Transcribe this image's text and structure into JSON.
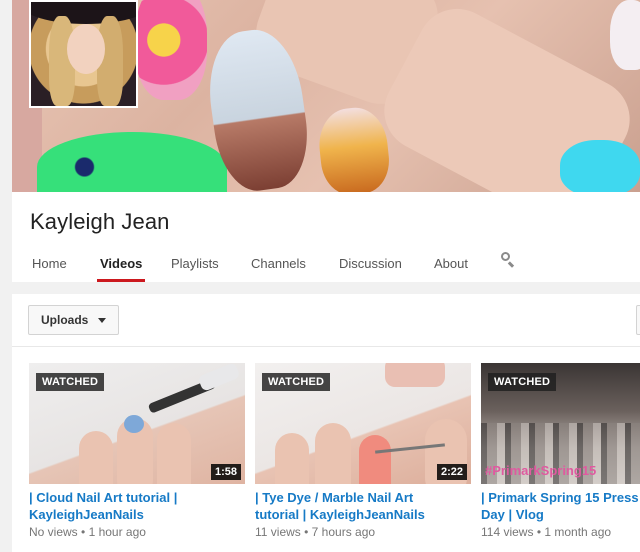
{
  "channel": {
    "name": "Kayleigh Jean",
    "tabs": [
      {
        "label": "Home",
        "active": false
      },
      {
        "label": "Videos",
        "active": true
      },
      {
        "label": "Playlists",
        "active": false
      },
      {
        "label": "Channels",
        "active": false
      },
      {
        "label": "Discussion",
        "active": false
      },
      {
        "label": "About",
        "active": false
      }
    ],
    "search_icon": "search-icon"
  },
  "filter": {
    "uploads_label": "Uploads",
    "dropdown_icon": "caret-down-icon"
  },
  "colors": {
    "accent": "#cc181e",
    "link": "#167ac6",
    "meta": "#767676"
  },
  "videos": [
    {
      "badge": "WATCHED",
      "duration": "1:58",
      "title_line1": "| Cloud Nail Art tutorial |",
      "title_line2": "KayleighJeanNails",
      "views": "No views",
      "age": "1 hour ago"
    },
    {
      "badge": "WATCHED",
      "duration": "2:22",
      "title_line1": "| Tye Dye / Marble Nail Art",
      "title_line2": "tutorial | KayleighJeanNails",
      "views": "11 views",
      "age": "7 hours ago"
    },
    {
      "badge": "WATCHED",
      "overlay_text": "#PrimarkSpring15",
      "title_line1": "| Primark Spring 15 Press",
      "title_line2": "Day | Vlog",
      "views": "114 views",
      "age": "1 month ago"
    }
  ]
}
